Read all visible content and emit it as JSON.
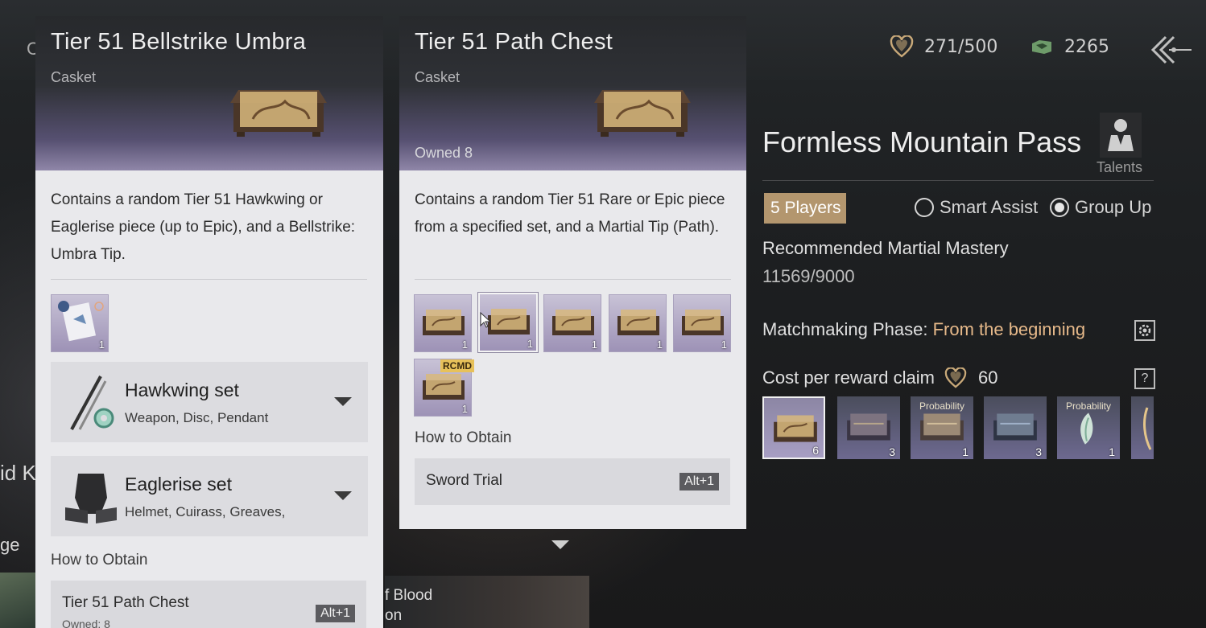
{
  "background": {
    "left_fragment_top": "C",
    "left_fragment_mid": "id K",
    "left_fragment_low": "ge",
    "blood_text_line1": "f Blood",
    "blood_text_line2": "on"
  },
  "currency": {
    "hearts_icon": "heart-icon",
    "hearts_value": "271/500",
    "jade_icon": "jade-icon",
    "jade_value": "2265"
  },
  "panel1": {
    "title": "Tier 51 Bellstrike Umbra",
    "type": "Casket",
    "description": "Contains a random Tier 51 Hawkwing or Eaglerise piece (up to Epic), and a Bellstrike: Umbra Tip.",
    "tip_qty": "1",
    "sets": [
      {
        "name": "Hawkwing set",
        "parts": "Weapon, Disc, Pendant"
      },
      {
        "name": "Eaglerise set",
        "parts": "Helmet, Cuirass, Greaves,"
      }
    ],
    "obtain_label": "How to Obtain",
    "obtain": {
      "name": "Tier 51 Path Chest",
      "sub": "Owned: 8",
      "hotkey": "Alt+1"
    }
  },
  "panel2": {
    "title": "Tier 51 Path Chest",
    "type": "Casket",
    "owned": "Owned 8",
    "description": "Contains a random Tier 51 Rare or Epic piece from a specified set, and a Martial Tip (Path).",
    "slots": [
      {
        "qty": "1"
      },
      {
        "qty": "1"
      },
      {
        "qty": "1"
      },
      {
        "qty": "1"
      },
      {
        "qty": "1"
      },
      {
        "qty": "1",
        "badge": "RCMD"
      }
    ],
    "obtain_label": "How to Obtain",
    "obtain": {
      "name": "Sword Trial",
      "hotkey": "Alt+1"
    }
  },
  "dungeon": {
    "title": "Formless Mountain Pass",
    "talents_label": "Talents",
    "players": "5 Players",
    "smart_assist": "Smart Assist",
    "group_up": "Group Up",
    "group_up_selected": true,
    "mastery_label": "Recommended Martial Mastery",
    "mastery_value": "11569/9000",
    "phase_label": "Matchmaking Phase:",
    "phase_value": "From the beginning",
    "cost_label": "Cost per reward claim",
    "cost_value": "60",
    "help": "?",
    "rewards": [
      {
        "qty": "6",
        "prob": ""
      },
      {
        "qty": "3",
        "prob": ""
      },
      {
        "qty": "1",
        "prob": "Probability"
      },
      {
        "qty": "3",
        "prob": ""
      },
      {
        "qty": "1",
        "prob": "Probability"
      }
    ]
  },
  "colors": {
    "accent_gold": "#b3966e",
    "phase_orange": "#e6b98a",
    "panel_bg": "#e9e9ec",
    "rarity_purple": "#9d92b6"
  }
}
